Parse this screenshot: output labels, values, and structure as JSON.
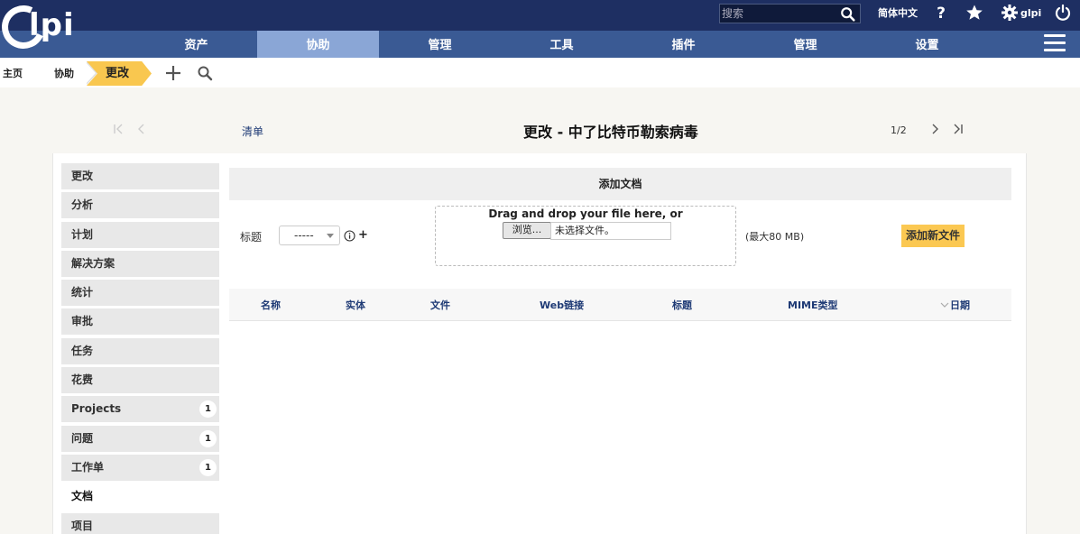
{
  "header": {
    "logo": "Glpi",
    "search_placeholder": "搜索",
    "language": "简体中文",
    "user": "glpi",
    "nav": [
      "资产",
      "协助",
      "管理",
      "工具",
      "插件",
      "管理",
      "设置"
    ],
    "active_nav": 1
  },
  "breadcrumb": {
    "items": [
      "主页",
      "协助",
      "更改"
    ]
  },
  "title_row": {
    "list_link": "清单",
    "title": "更改 - 中了比特币勒索病毒",
    "counter": "1/2"
  },
  "side_tabs": [
    {
      "label": "更改",
      "badge": ""
    },
    {
      "label": "分析",
      "badge": ""
    },
    {
      "label": "计划",
      "badge": ""
    },
    {
      "label": "解决方案",
      "badge": ""
    },
    {
      "label": "统计",
      "badge": ""
    },
    {
      "label": "审批",
      "badge": ""
    },
    {
      "label": "任务",
      "badge": ""
    },
    {
      "label": "花费",
      "badge": ""
    },
    {
      "label": "Projects",
      "badge": "1"
    },
    {
      "label": "问题",
      "badge": "1"
    },
    {
      "label": "工作单",
      "badge": "1"
    },
    {
      "label": "文档",
      "badge": "",
      "active": true
    },
    {
      "label": "项目",
      "badge": ""
    }
  ],
  "form": {
    "header": "添加文档",
    "heading_label": "标题",
    "heading_select_value": "-----",
    "plus": "+",
    "drop_text": "Drag and drop your file here, or",
    "browse_label": "浏览...",
    "file_status": "未选择文件。",
    "max_size": "(最大80 MB)",
    "add_button": "添加新文件"
  },
  "doc_table": {
    "columns": [
      "名称",
      "实体",
      "文件",
      "Web链接",
      "标题",
      "MIME类型",
      "日期"
    ]
  },
  "colors": {
    "header_dark": "#1e2f62",
    "nav_bar": "#3a5a94",
    "nav_active": "#8aa6d6",
    "accent_yellow": "#fbc852",
    "link_blue": "#1e3a75"
  }
}
